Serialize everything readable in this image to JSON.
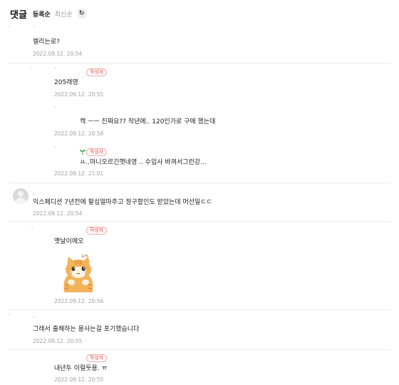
{
  "header": {
    "title": "댓글",
    "sort_registered": "등록순",
    "sort_latest": "최신순",
    "refresh_icon": "refresh-icon"
  },
  "comments": [
    {
      "text": "렐리는로?",
      "date": "2022.09.12. 20:54"
    },
    {
      "text": "205래영",
      "date": "2022.09.12. 20:55",
      "badge": "작성자"
    },
    {
      "text": "캑 ㅡㅡ 진짜요?? 작년에.. 120인가로 구매 했는데",
      "date": "2022.09.12. 20:58"
    },
    {
      "text": "ㅛ..마니오르긴햇네영 .. 수입사 바껴서그런강...",
      "date": "2022.09.12. 21:01",
      "badge": "작성자"
    },
    {
      "text": "익스페디션 7년전에 팔십얼마주고 정구할인도 받았는데 머선일ㄷㄷ",
      "date": "2022.09.12. 20:54"
    },
    {
      "text": "옛날이에오",
      "date": "2022.09.12. 20:56",
      "badge": "작성자",
      "sticker_caption": "훌쩍.."
    },
    {
      "text": "그래서 출해하는 용사는걸 포기했습니다",
      "date": "2022.09.12. 20:55"
    },
    {
      "text": "내년두 이럴듯용. ㅠ",
      "date": "2022.09.12. 20:55",
      "badge": "작성자"
    }
  ],
  "colors": {
    "badge": "#e04848",
    "badge_border": "#f2a9a9",
    "date": "#a0a0a0",
    "divider": "#ececec",
    "sprout": "#3aa14a",
    "sticker_fur": "#f4b35a"
  }
}
